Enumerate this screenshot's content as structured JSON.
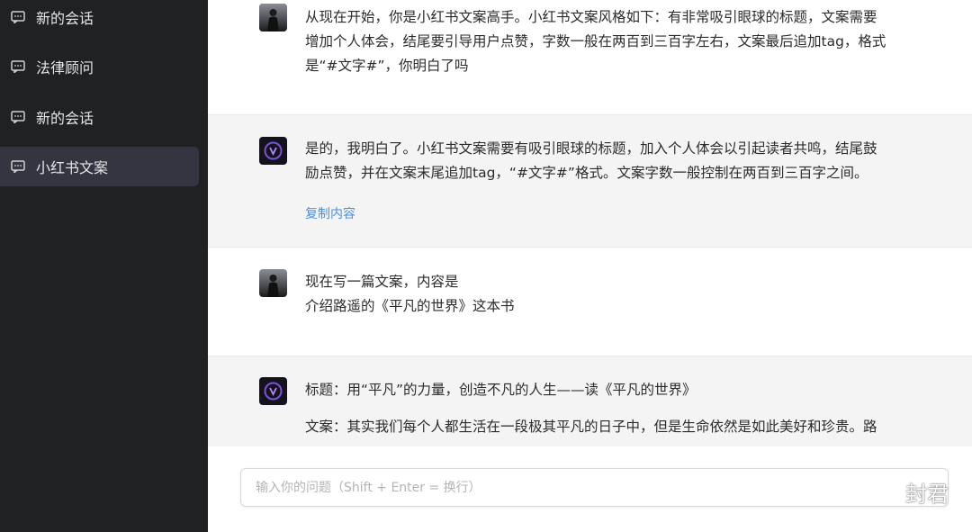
{
  "sidebar": {
    "items": [
      {
        "label": "新的会话",
        "icon": "chat-icon",
        "active": false
      },
      {
        "label": "法律顾问",
        "icon": "chat-icon",
        "active": false
      },
      {
        "label": "新的会话",
        "icon": "chat-icon",
        "active": false
      },
      {
        "label": "小红书文案",
        "icon": "chat-icon",
        "active": true
      }
    ]
  },
  "conversation": {
    "messages": [
      {
        "role": "user",
        "lines": [
          "从现在开始，你是小红书文案高手。小红书文案风格如下：有非常吸引眼球的标题，文案需要",
          "增加个人体会，结尾要引导用户点赞，字数一般在两百到三百字左右，文案最后追加tag，格式",
          "是“#文字#”，你明白了吗"
        ]
      },
      {
        "role": "assistant",
        "lines": [
          "是的，我明白了。小红书文案需要有吸引眼球的标题，加入个人体会以引起读者共鸣，结尾鼓",
          "励点赞，并在文案末尾追加tag，“#文字#”格式。文案字数一般控制在两百到三百字之间。"
        ],
        "action": "复制内容"
      },
      {
        "role": "user",
        "lines": [
          "现在写一篇文案，内容是",
          "介绍路遥的《平凡的世界》这本书"
        ]
      },
      {
        "role": "assistant",
        "lines": [
          "标题：用“平凡”的力量，创造不凡的人生——读《平凡的世界》",
          "文案：其实我们每个人都生活在一段极其平凡的日子中，但是生命依然是如此美好和珍贵。路"
        ]
      }
    ]
  },
  "input": {
    "placeholder": "输入你的问题（Shift + Enter = 换行）",
    "value": ""
  },
  "watermark": {
    "icon": "wechat-icon",
    "text": "封君"
  },
  "colors": {
    "sidebar_bg": "#202123",
    "sidebar_active": "#343541",
    "assistant_bg": "#f4f4f5",
    "link": "#4a90e2"
  }
}
